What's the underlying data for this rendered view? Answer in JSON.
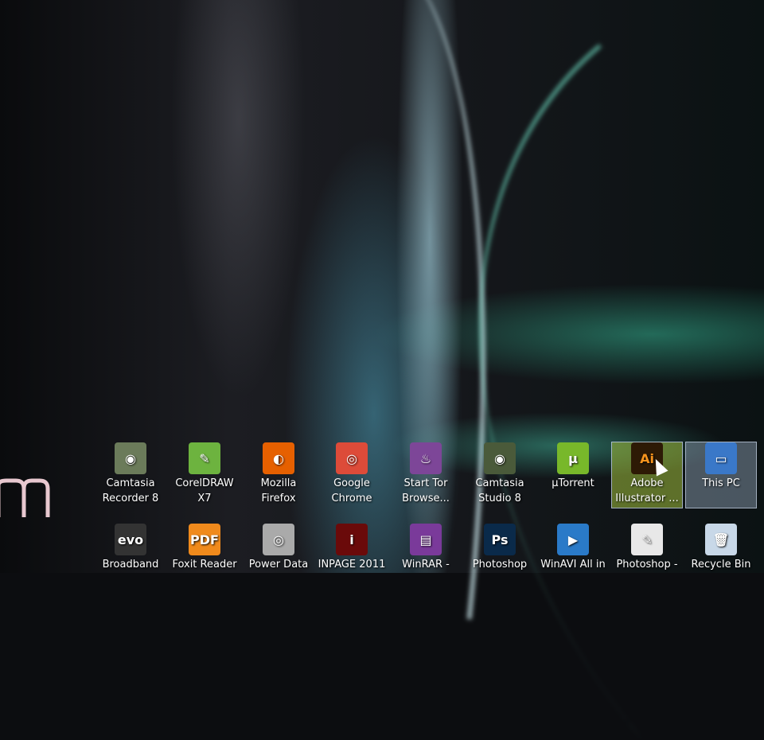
{
  "desktop": {
    "row1": [
      {
        "label": "Camtasia Recorder 8",
        "icon": "camtasia-recorder-icon",
        "color": "#6b7b5a"
      },
      {
        "label": "CorelDRAW X7",
        "icon": "coreldraw-icon",
        "color": "#6db33f"
      },
      {
        "label": "Mozilla Firefox",
        "icon": "firefox-icon",
        "color": "#e66000"
      },
      {
        "label": "Google Chrome",
        "icon": "chrome-icon",
        "color": "#dd4b39"
      },
      {
        "label": "Start Tor Browse...",
        "icon": "tor-icon",
        "color": "#7d4698"
      },
      {
        "label": "Camtasia Studio 8",
        "icon": "camtasia-studio-icon",
        "color": "#4a5a3a"
      },
      {
        "label": "µTorrent",
        "icon": "utorrent-icon",
        "color": "#78b82a"
      },
      {
        "label": "Adobe Illustrator ...",
        "icon": "illustrator-icon",
        "color": "#2d1a05"
      },
      {
        "label": "This PC",
        "icon": "computer-icon",
        "color": "#3a78c8"
      }
    ],
    "row2": [
      {
        "label": "Broadband",
        "icon": "evo-icon",
        "color": "#333333"
      },
      {
        "label": "Foxit Reader",
        "icon": "pdf-icon",
        "color": "#f08a1c"
      },
      {
        "label": "Power Data",
        "icon": "disc-icon",
        "color": "#aaaaaa"
      },
      {
        "label": "INPAGE 2011",
        "icon": "inpage-icon",
        "color": "#6a0a0a"
      },
      {
        "label": "WinRAR -",
        "icon": "winrar-icon",
        "color": "#7a3a9a"
      },
      {
        "label": "Photoshop",
        "icon": "photoshop-icon",
        "color": "#0a2a4a"
      },
      {
        "label": "WinAVI All in",
        "icon": "winavi-icon",
        "color": "#2a7ac8"
      },
      {
        "label": "Photoshop -",
        "icon": "photoshop-file-icon",
        "color": "#e8e8e8"
      },
      {
        "label": "Recycle Bin",
        "icon": "recycle-bin-icon",
        "color": "#c8d8e8"
      }
    ],
    "glyphs": {
      "row1": [
        "◉",
        "✎",
        "◐",
        "◎",
        "♨",
        "◉",
        "µ",
        "Ai",
        "▭"
      ],
      "row2": [
        "evo",
        "PDF",
        "◎",
        "i",
        "▤",
        "Ps",
        "▶",
        "✎",
        "🗑"
      ]
    }
  }
}
